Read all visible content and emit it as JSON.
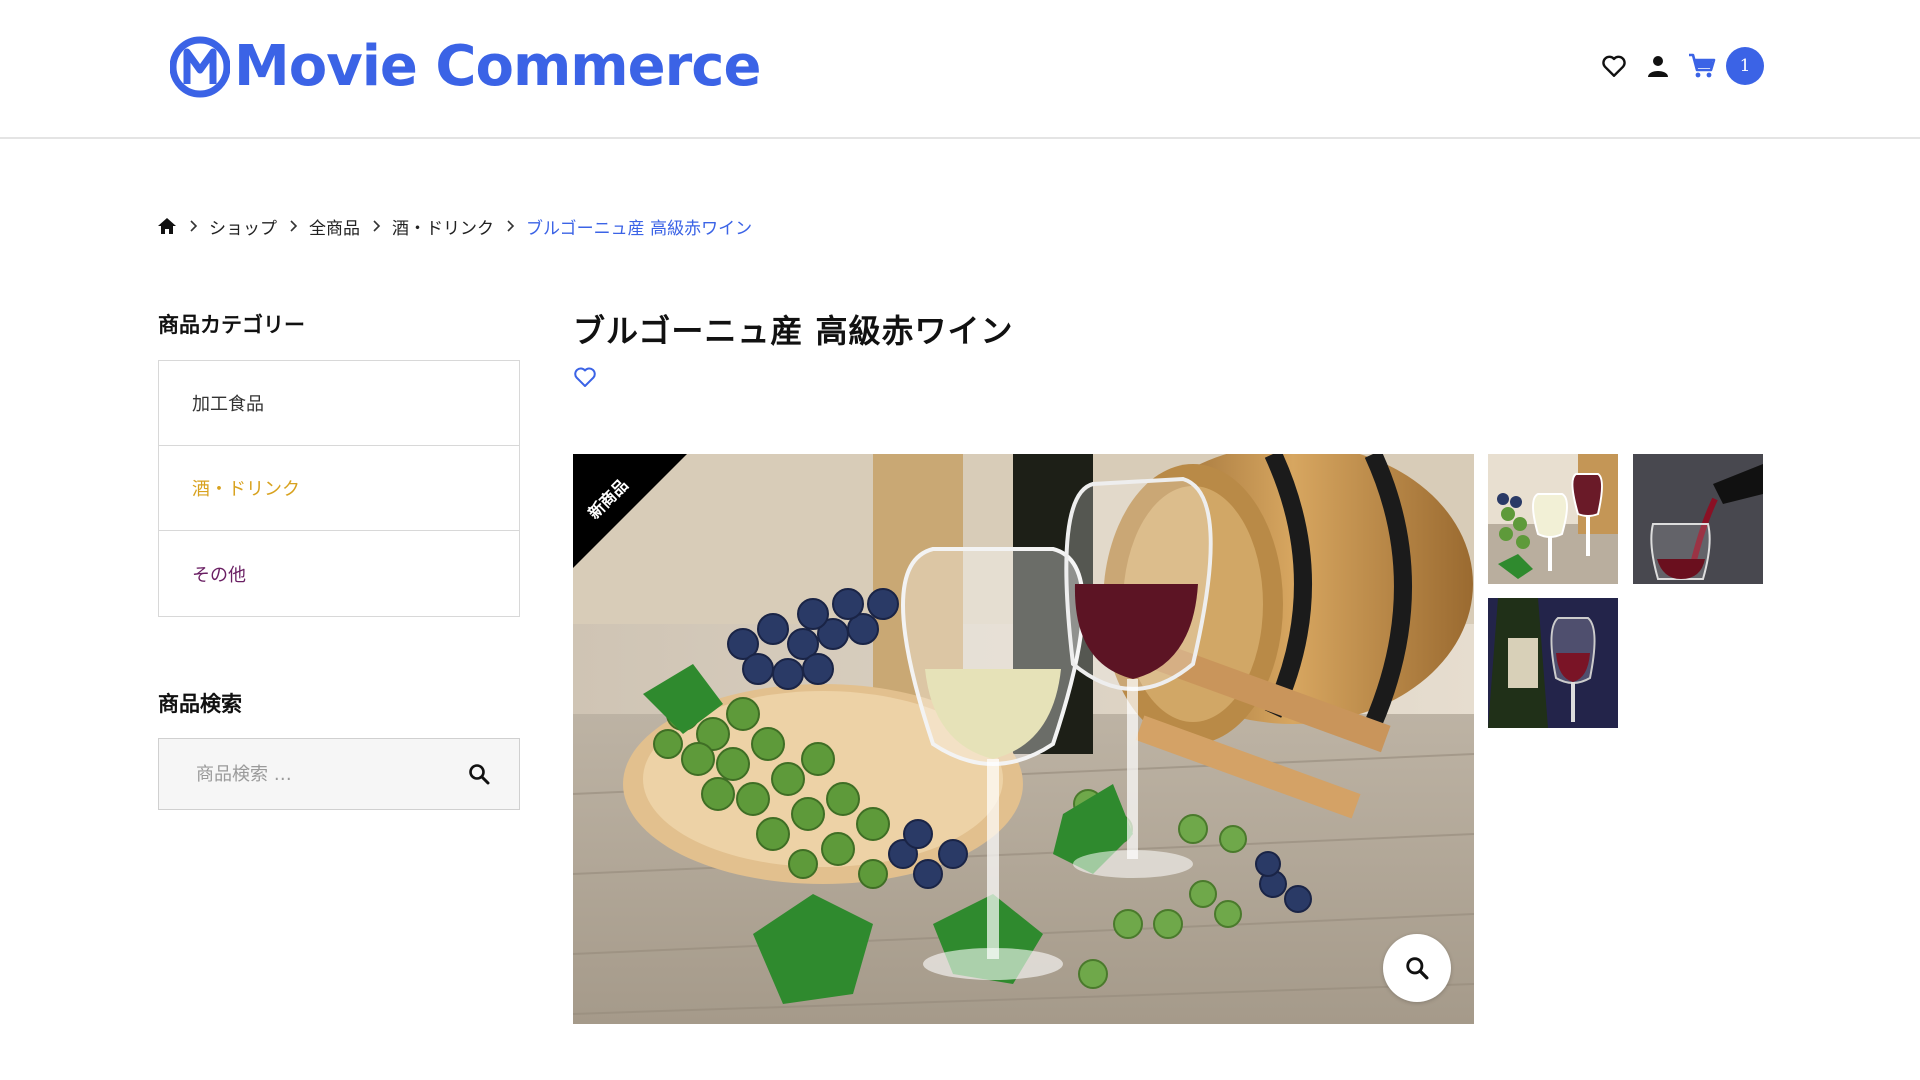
{
  "header": {
    "logo_text": "Movie Commerce",
    "cart_count": "1",
    "icons": [
      "heart-icon",
      "user-icon",
      "cart-icon"
    ],
    "accent_color": "#3b63e6"
  },
  "breadcrumb": {
    "items": [
      "ショップ",
      "全商品",
      "酒・ドリンク"
    ],
    "current": "ブルゴーニュ産 高級赤ワイン"
  },
  "sidebar": {
    "category_title": "商品カテゴリー",
    "categories": [
      {
        "label": "加工食品",
        "color": "#333333"
      },
      {
        "label": "酒・ドリンク",
        "color": "#d8a21f"
      },
      {
        "label": "その他",
        "color": "#6a1f63"
      }
    ],
    "search_title": "商品検索",
    "search_placeholder": "商品検索 …"
  },
  "product": {
    "title": "ブルゴーニュ産 高級赤ワイン",
    "badge": "新商品"
  }
}
